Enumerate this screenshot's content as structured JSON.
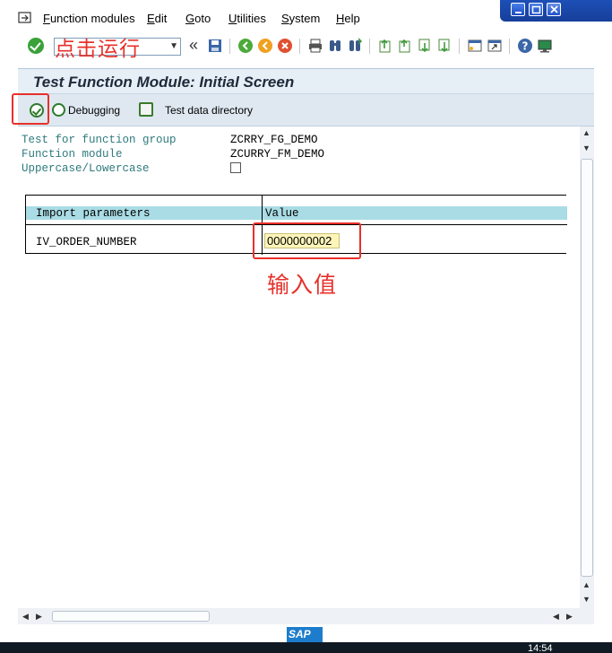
{
  "menubar": {
    "items": [
      {
        "label": "Function modules",
        "mnemonic": "F",
        "rest": "unction modules"
      },
      {
        "label": "Edit",
        "mnemonic": "E",
        "rest": "dit"
      },
      {
        "label": "Goto",
        "mnemonic": "G",
        "rest": "oto"
      },
      {
        "label": "Utilities",
        "mnemonic": "U",
        "rest": "tilities"
      },
      {
        "label": "System",
        "mnemonic": "S",
        "rest": "ystem"
      },
      {
        "label": "Help",
        "mnemonic": "H",
        "rest": "elp"
      }
    ]
  },
  "toolbar": {
    "command_overlay": "点击运行",
    "colors": {
      "ok": "#3aa13a",
      "annotation": "#e8302a"
    }
  },
  "title": "Test Function Module: Initial Screen",
  "app_toolbar": {
    "debugging_label": "Debugging",
    "test_data_label": "Test data directory"
  },
  "fields": {
    "function_group_label": "Test for function group",
    "function_group_value": "ZCRRY_FG_DEMO",
    "function_module_label": "Function module",
    "function_module_value": "ZCURRY_FM_DEMO",
    "case_label": "Uppercase/Lowercase"
  },
  "table": {
    "headers": [
      "Import parameters",
      "Value"
    ],
    "rows": [
      {
        "param": "IV_ORDER_NUMBER",
        "value": "0000000002"
      }
    ]
  },
  "annotation_input": "输入值",
  "status": {
    "logo": "SAP",
    "clock": "14:54"
  }
}
